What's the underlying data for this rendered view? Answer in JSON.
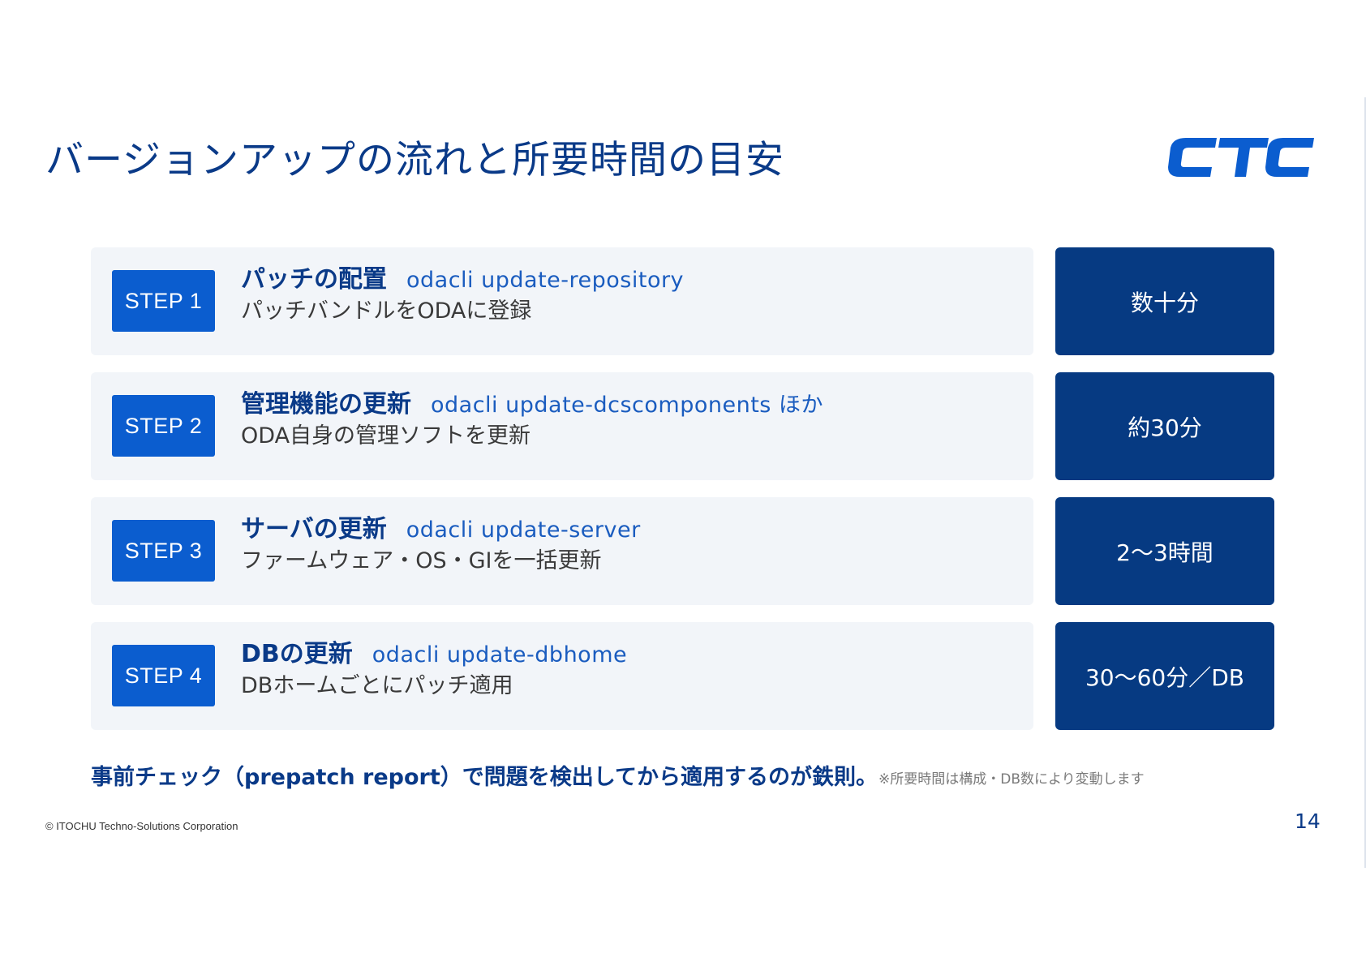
{
  "title": "バージョンアップの流れと所要時間の目安",
  "logo": {
    "text": "CTC",
    "color": "#0b5dcf"
  },
  "steps": [
    {
      "badge": "STEP 1",
      "name": "パッチの配置",
      "command": "odacli update-repository",
      "description": "パッチバンドルをODAに登録",
      "duration": "数十分"
    },
    {
      "badge": "STEP 2",
      "name": "管理機能の更新",
      "command": "odacli update-dcscomponents ほか",
      "description": "ODA自身の管理ソフトを更新",
      "duration": "約30分"
    },
    {
      "badge": "STEP 3",
      "name": "サーバの更新",
      "command": "odacli update-server",
      "description": "ファームウェア・OS・GIを一括更新",
      "duration": "2〜3時間"
    },
    {
      "badge": "STEP 4",
      "name": "DBの更新",
      "command": "odacli update-dbhome",
      "description": "DBホームごとにパッチ適用",
      "duration": "30〜60分／DB"
    }
  ],
  "note": {
    "main": "事前チェック（prepatch report）で問題を検出してから適用するのが鉄則。",
    "sub": "※所要時間は構成・DB数により変動します"
  },
  "footer": {
    "copyright": "© ITOCHU Techno-Solutions Corporation",
    "page_number": "14"
  },
  "colors": {
    "title": "#0a3a88",
    "badge": "#0b5dcf",
    "time_box": "#063a82",
    "card_bg": "#f2f5f9",
    "command": "#1a5cbf"
  }
}
